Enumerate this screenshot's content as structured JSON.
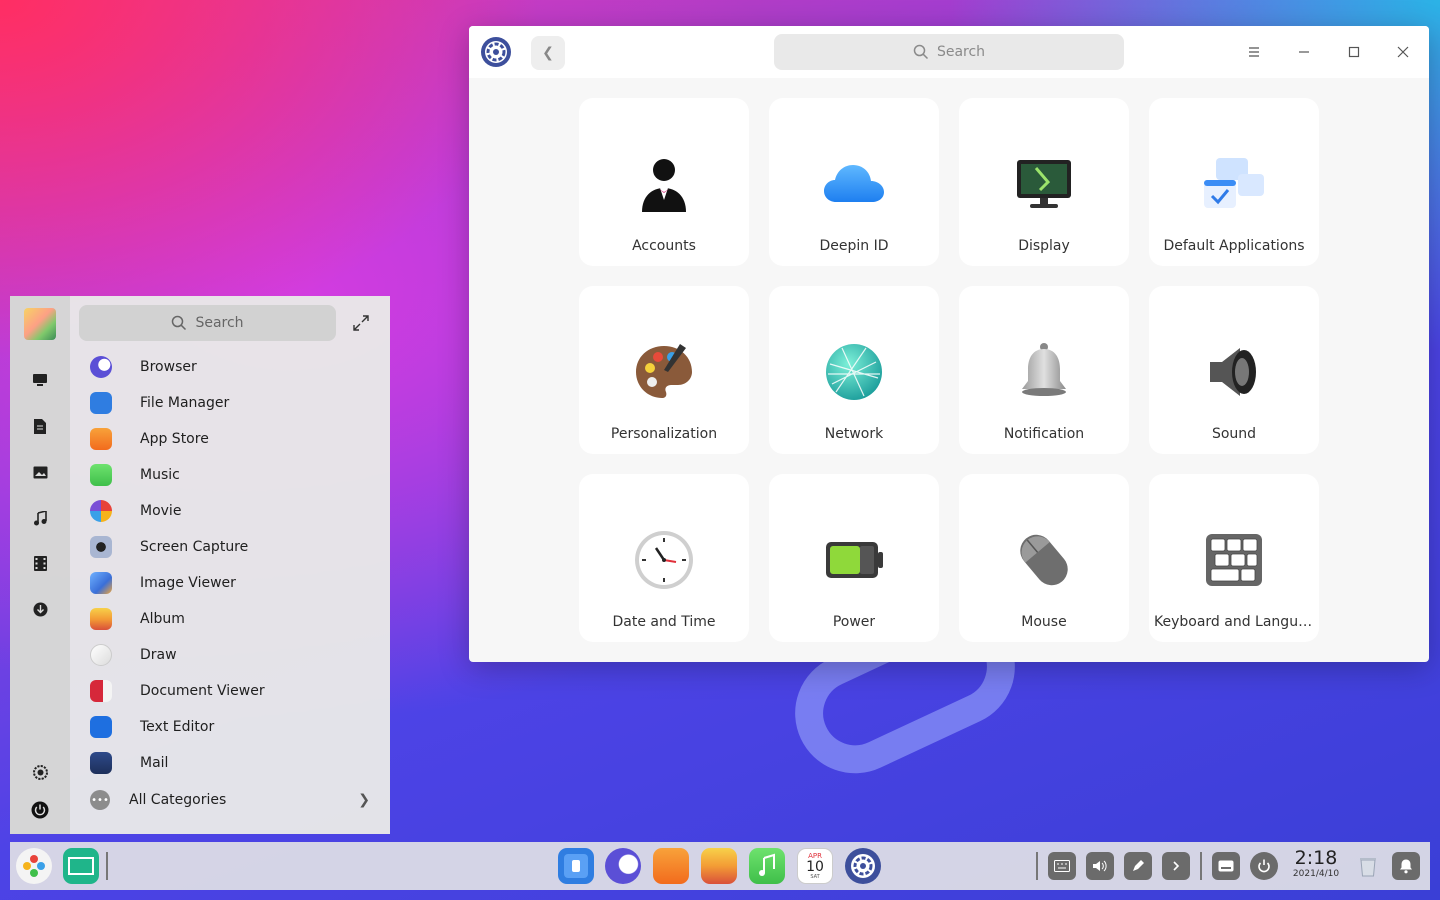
{
  "control_center": {
    "search_placeholder": "Search",
    "back_icon": "chevron-left-icon",
    "window_buttons": [
      "menu-icon",
      "minimize-icon",
      "maximize-icon",
      "close-icon"
    ],
    "tiles": [
      {
        "label": "Accounts",
        "icon": "accounts-icon"
      },
      {
        "label": "Deepin ID",
        "icon": "cloud-icon"
      },
      {
        "label": "Display",
        "icon": "display-icon"
      },
      {
        "label": "Default Applications",
        "icon": "default-applications-icon"
      },
      {
        "label": "Personalization",
        "icon": "palette-icon"
      },
      {
        "label": "Network",
        "icon": "network-globe-icon"
      },
      {
        "label": "Notification",
        "icon": "bell-icon"
      },
      {
        "label": "Sound",
        "icon": "speaker-icon"
      },
      {
        "label": "Date and Time",
        "icon": "clock-icon"
      },
      {
        "label": "Power",
        "icon": "battery-icon"
      },
      {
        "label": "Mouse",
        "icon": "mouse-icon"
      },
      {
        "label": "Keyboard and Langua...",
        "icon": "keyboard-icon"
      }
    ]
  },
  "launcher": {
    "search_placeholder": "Search",
    "apps": [
      {
        "name": "Browser",
        "color": "#5b4fd6"
      },
      {
        "name": "File Manager",
        "color": "#2f7de1"
      },
      {
        "name": "App Store",
        "color": "#f26b1d"
      },
      {
        "name": "Music",
        "color": "#3fbf4a"
      },
      {
        "name": "Movie",
        "color": "#222a44"
      },
      {
        "name": "Screen Capture",
        "color": "#5a6a8a"
      },
      {
        "name": "Image Viewer",
        "color": "#3a6fd8"
      },
      {
        "name": "Album",
        "color": "#f39c35"
      },
      {
        "name": "Draw",
        "color": "#e9e9e9"
      },
      {
        "name": "Document Viewer",
        "color": "#d6283a"
      },
      {
        "name": "Text Editor",
        "color": "#1e6fe0"
      },
      {
        "name": "Mail",
        "color": "#1d2f5a"
      }
    ],
    "all_categories": "All Categories"
  },
  "dock": {
    "clock_time": "2:18",
    "clock_date": "2021/4/10",
    "calendar_month": "APR",
    "calendar_day": "10",
    "calendar_weekday": "SAT"
  }
}
